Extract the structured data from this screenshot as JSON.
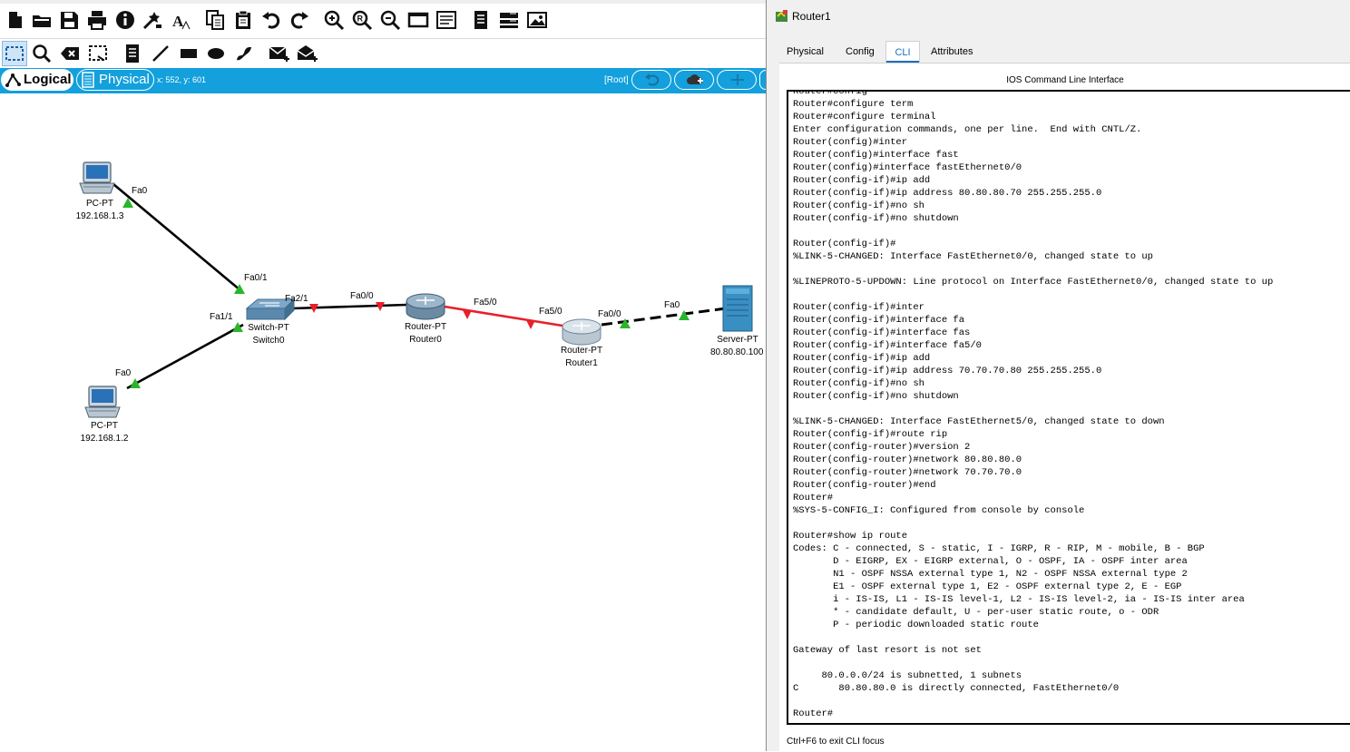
{
  "toolbar_top": {
    "buttons": [
      "new-file-icon",
      "open-folder-icon",
      "save-icon",
      "print-icon",
      "info-icon",
      "activity-wizard-icon",
      "font-icon",
      "copy-icon",
      "paste-icon",
      "undo-icon",
      "redo-icon",
      "zoom-in-icon",
      "zoom-reset-icon",
      "zoom-out-icon",
      "drawing-palette-icon",
      "custom-device-icon",
      "notes-icon",
      "viewport-icon",
      "picture-icon"
    ]
  },
  "toolbar_tools": {
    "buttons": [
      "select-icon",
      "inspect-icon",
      "delete-icon",
      "resize-icon",
      "note-icon",
      "line-icon",
      "rectangle-icon",
      "ellipse-icon",
      "freeform-icon",
      "add-simple-pdu-icon",
      "add-complex-pdu-icon"
    ]
  },
  "modebar": {
    "logical": "Logical",
    "physical": "Physical",
    "coords": "x: 552, y: 601",
    "root": "[Root]"
  },
  "topology": {
    "devices": [
      {
        "id": "pc1",
        "line1": "PC-PT",
        "line2": "192.168.1.3"
      },
      {
        "id": "pc2",
        "line1": "PC-PT",
        "line2": "192.168.1.2"
      },
      {
        "id": "switch0",
        "line1": "Switch-PT",
        "line2": "Switch0"
      },
      {
        "id": "router0",
        "line1": "Router-PT",
        "line2": "Router0"
      },
      {
        "id": "router1",
        "line1": "Router-PT",
        "line2": "Router1"
      },
      {
        "id": "server",
        "line1": "Server-PT",
        "line2": "80.80.80.100"
      }
    ],
    "ports": {
      "pc1_fa0": "Fa0",
      "sw_fa01": "Fa0/1",
      "sw_fa11": "Fa1/1",
      "pc2_fa0": "Fa0",
      "sw_fa21": "Fa2/1",
      "r0_fa00": "Fa0/0",
      "r0_fa50": "Fa5/0",
      "r1_fa50": "Fa5/0",
      "r1_fa00": "Fa0/0",
      "srv_fa0": "Fa0"
    },
    "colors": {
      "link_up": "#2bb52b",
      "link_down": "#e8202a",
      "cable": "#000000"
    }
  },
  "router_window": {
    "title": "Router1",
    "tabs": [
      "Physical",
      "Config",
      "CLI",
      "Attributes"
    ],
    "active_tab": "CLI",
    "heading": "IOS Command Line Interface",
    "cli_output": "Router#config\nRouter#configure term\nRouter#configure terminal\nEnter configuration commands, one per line.  End with CNTL/Z.\nRouter(config)#inter\nRouter(config)#interface fast\nRouter(config)#interface fastEthernet0/0\nRouter(config-if)#ip add\nRouter(config-if)#ip address 80.80.80.70 255.255.255.0\nRouter(config-if)#no sh\nRouter(config-if)#no shutdown\n\nRouter(config-if)#\n%LINK-5-CHANGED: Interface FastEthernet0/0, changed state to up\n\n%LINEPROTO-5-UPDOWN: Line protocol on Interface FastEthernet0/0, changed state to up\n\nRouter(config-if)#inter\nRouter(config-if)#interface fa\nRouter(config-if)#interface fas\nRouter(config-if)#interface fa5/0\nRouter(config-if)#ip add\nRouter(config-if)#ip address 70.70.70.80 255.255.255.0\nRouter(config-if)#no sh\nRouter(config-if)#no shutdown\n\n%LINK-5-CHANGED: Interface FastEthernet5/0, changed state to down\nRouter(config-if)#route rip\nRouter(config-router)#version 2\nRouter(config-router)#network 80.80.80.0\nRouter(config-router)#network 70.70.70.0\nRouter(config-router)#end\nRouter#\n%SYS-5-CONFIG_I: Configured from console by console\n\nRouter#show ip route\nCodes: C - connected, S - static, I - IGRP, R - RIP, M - mobile, B - BGP\n       D - EIGRP, EX - EIGRP external, O - OSPF, IA - OSPF inter area\n       N1 - OSPF NSSA external type 1, N2 - OSPF NSSA external type 2\n       E1 - OSPF external type 1, E2 - OSPF external type 2, E - EGP\n       i - IS-IS, L1 - IS-IS level-1, L2 - IS-IS level-2, ia - IS-IS inter area\n       * - candidate default, U - per-user static route, o - ODR\n       P - periodic downloaded static route\n\nGateway of last resort is not set\n\n     80.0.0.0/24 is subnetted, 1 subnets\nC       80.80.80.0 is directly connected, FastEthernet0/0\n\nRouter#",
    "exit_hint": "Ctrl+F6 to exit CLI focus"
  }
}
